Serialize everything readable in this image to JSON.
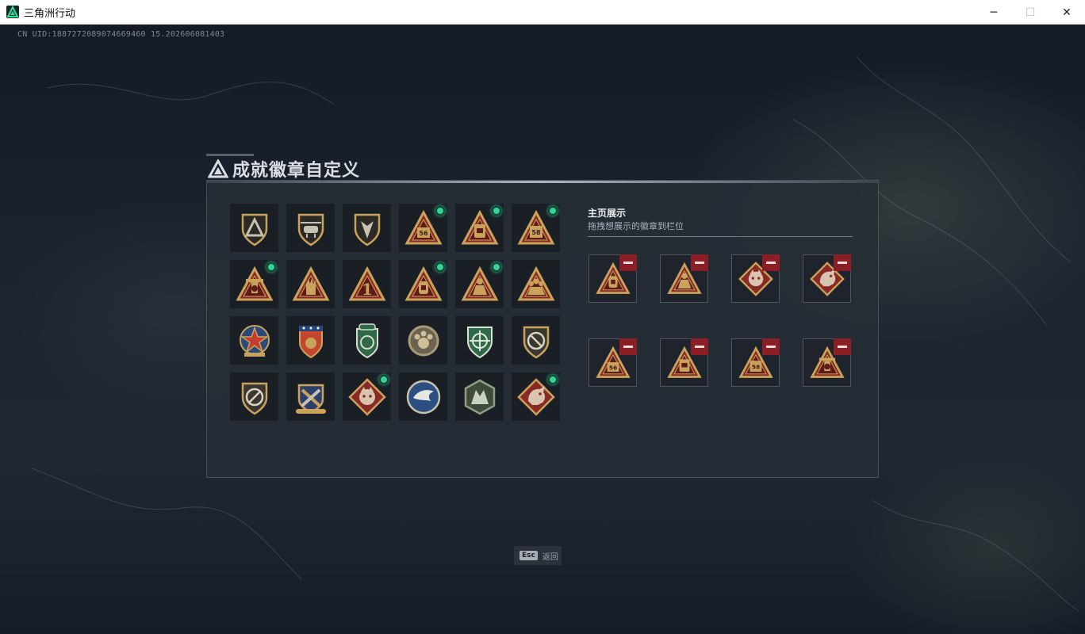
{
  "window": {
    "title": "三角洲行动",
    "controls": {
      "minimize": "─",
      "maximize": "☐",
      "close": "✕"
    }
  },
  "uid_text": "CN UID:1887272089074669460 15.202606081403",
  "dialog": {
    "title": "成就徽章自定义"
  },
  "collection": {
    "badges": [
      {
        "icon": "shield-delta-emblem-icon",
        "new": false
      },
      {
        "icon": "shield-helicopter-emblem-icon",
        "new": false
      },
      {
        "icon": "shield-arrow-emblem-icon",
        "new": false
      },
      {
        "icon": "triangle-badge-56-icon",
        "new": true
      },
      {
        "icon": "triangle-badge-backpack-icon",
        "new": true
      },
      {
        "icon": "triangle-badge-58-icon",
        "new": true
      },
      {
        "icon": "triangle-badge-tower-icon",
        "new": true
      },
      {
        "icon": "triangle-badge-hand-icon",
        "new": false
      },
      {
        "icon": "triangle-badge-number-one-icon",
        "new": false
      },
      {
        "icon": "triangle-badge-lantern-icon",
        "new": true
      },
      {
        "icon": "triangle-badge-soldier-icon",
        "new": true
      },
      {
        "icon": "triangle-badge-squad-icon",
        "new": false
      },
      {
        "icon": "star-medal-emblem-icon",
        "new": false
      },
      {
        "icon": "blue-star-shield-emblem-icon",
        "new": false
      },
      {
        "icon": "green-lion-shield-emblem-icon",
        "new": false
      },
      {
        "icon": "round-paw-emblem-icon",
        "new": false
      },
      {
        "icon": "green-crosshair-shield-icon",
        "new": false
      },
      {
        "icon": "no-rifle-shield-icon",
        "new": false
      },
      {
        "icon": "no-knife-shield-icon",
        "new": false
      },
      {
        "icon": "winged-cross-emblem-icon",
        "new": false
      },
      {
        "icon": "diamond-beast-badge-icon",
        "new": true
      },
      {
        "icon": "round-eagle-emblem-icon",
        "new": false
      },
      {
        "icon": "hex-wolf-emblem-icon",
        "new": false
      },
      {
        "icon": "diamond-dragon-badge-icon",
        "new": true
      }
    ]
  },
  "showcase": {
    "title": "主页展示",
    "subtitle": "拖拽想展示的徽章到栏位",
    "slots": [
      {
        "icon": "triangle-badge-lantern-icon"
      },
      {
        "icon": "triangle-badge-soldier-icon"
      },
      {
        "icon": "diamond-beast-badge-icon"
      },
      {
        "icon": "diamond-dragon-badge-icon"
      },
      {
        "icon": "triangle-badge-56-icon"
      },
      {
        "icon": "triangle-badge-backpack-icon"
      },
      {
        "icon": "triangle-badge-58-icon"
      },
      {
        "icon": "triangle-badge-tower-icon"
      }
    ]
  },
  "footer": {
    "esc_key": "Esc",
    "esc_label": "返回"
  },
  "colors": {
    "gold": "#c9a35b",
    "badge_red": "#8a2a26",
    "new_dot": "#33d39a",
    "remove_red": "#8c1f25"
  }
}
